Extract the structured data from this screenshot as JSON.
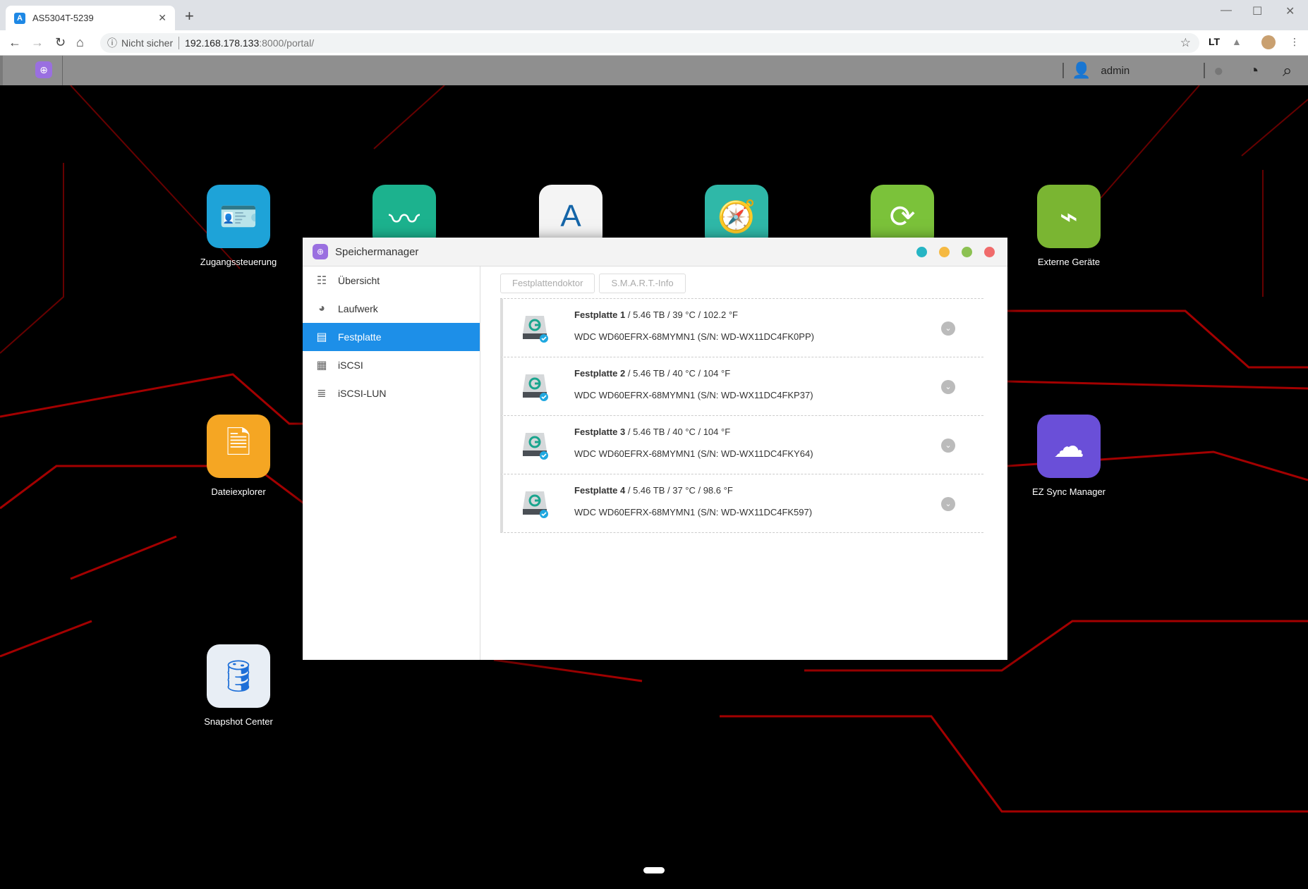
{
  "browser": {
    "tab_title": "AS5304T-5239",
    "security": "Nicht sicher",
    "url_host": "192.168.178.133",
    "url_rest": ":8000/portal/"
  },
  "topbar": {
    "user": "admin",
    "icons": [
      "user-icon",
      "bell-icon",
      "dashboard-icon",
      "search-icon"
    ]
  },
  "desktop": {
    "apps": [
      {
        "label": "Zugangssteuerung",
        "color": "#1ea3d8",
        "icon": "id-card-icon"
      },
      {
        "label": "",
        "color": "#1cb28e",
        "icon": "activity-monitor-icon"
      },
      {
        "label": "",
        "color": "#f4f4f4",
        "icon": "app-central-icon"
      },
      {
        "label": "",
        "color": "#2fb8a8",
        "icon": "storage-manager-book-icon"
      },
      {
        "label": "",
        "color": "#7bc23a",
        "icon": "backup-icon"
      },
      {
        "label": "Externe Geräte",
        "color": "#7ab532",
        "icon": "usb-drive-icon"
      },
      {
        "label": "Dateiexplorer",
        "color": "#f5a623",
        "icon": "file-explorer-icon"
      },
      {
        "label": "EZ Sync Manager",
        "color": "#6a4fd8",
        "icon": "cloud-sync-icon"
      },
      {
        "label": "Snapshot Center",
        "color": "#e8eef5",
        "icon": "snapshot-icon"
      }
    ]
  },
  "window": {
    "title": "Speichermanager",
    "sidebar": [
      {
        "label": "Übersicht",
        "icon": "list-icon"
      },
      {
        "label": "Laufwerk",
        "icon": "volume-icon"
      },
      {
        "label": "Festplatte",
        "icon": "disk-icon",
        "active": true
      },
      {
        "label": "iSCSI",
        "icon": "iscsi-icon"
      },
      {
        "label": "iSCSI-LUN",
        "icon": "lun-icon"
      }
    ],
    "buttons": {
      "doctor": "Festplattendoktor",
      "smart": "S.M.A.R.T.-Info"
    },
    "disks": [
      {
        "name": "Festplatte 1",
        "info": " / 5.46 TB / 39 °C / 102.2 °F",
        "model": "WDC WD60EFRX-68MYMN1 (S/N: WD-WX11DC4FK0PP)"
      },
      {
        "name": "Festplatte 2",
        "info": " / 5.46 TB / 40 °C / 104 °F",
        "model": "WDC WD60EFRX-68MYMN1 (S/N: WD-WX11DC4FKP37)"
      },
      {
        "name": "Festplatte 3",
        "info": " / 5.46 TB / 40 °C / 104 °F",
        "model": "WDC WD60EFRX-68MYMN1 (S/N: WD-WX11DC4FKY64)"
      },
      {
        "name": "Festplatte 4",
        "info": " / 5.46 TB / 37 °C / 98.6 °F",
        "model": "WDC WD60EFRX-68MYMN1 (S/N: WD-WX11DC4FK597)"
      }
    ],
    "dot_colors": [
      "#26b5c4",
      "#f5b942",
      "#8cc152",
      "#f06b6b"
    ]
  }
}
